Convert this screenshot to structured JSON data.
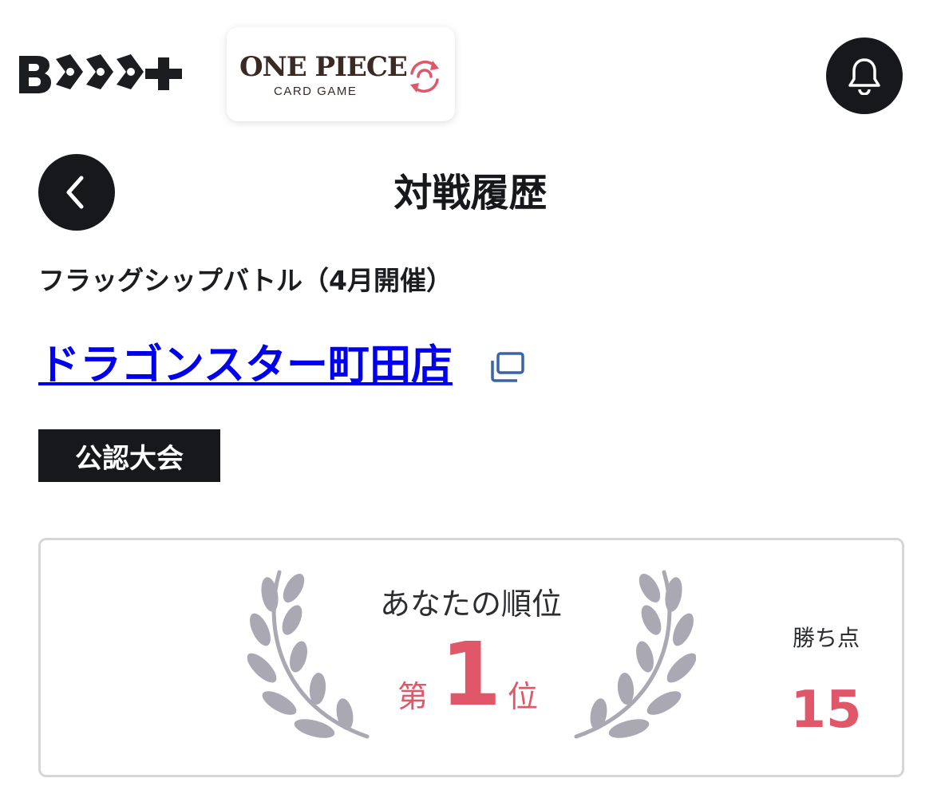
{
  "header": {
    "platform_logo_text": "BTCG+",
    "game_logo": {
      "title": "ONE PIECE",
      "subtitle": "CARD GAME",
      "cycle_icon": "cycle-arrows-icon"
    },
    "notification_icon": "bell-icon"
  },
  "page": {
    "back_icon": "chevron-left-icon",
    "title": "対戦履歴"
  },
  "event": {
    "name": "フラッグシップバトル（4月開催）",
    "store_name": "ドラゴンスター町田店",
    "external_link_icon": "external-link-icon",
    "badge": "公認大会"
  },
  "result": {
    "caption": "あなたの順位",
    "rank_prefix": "第",
    "rank": "1",
    "rank_suffix": "位",
    "points_label": "勝ち点",
    "points": "15"
  },
  "colors": {
    "accent_red": "#e0576a",
    "dark": "#16181c",
    "link_blue": "#0000ee",
    "wreath_gray": "#a9a8b3"
  }
}
